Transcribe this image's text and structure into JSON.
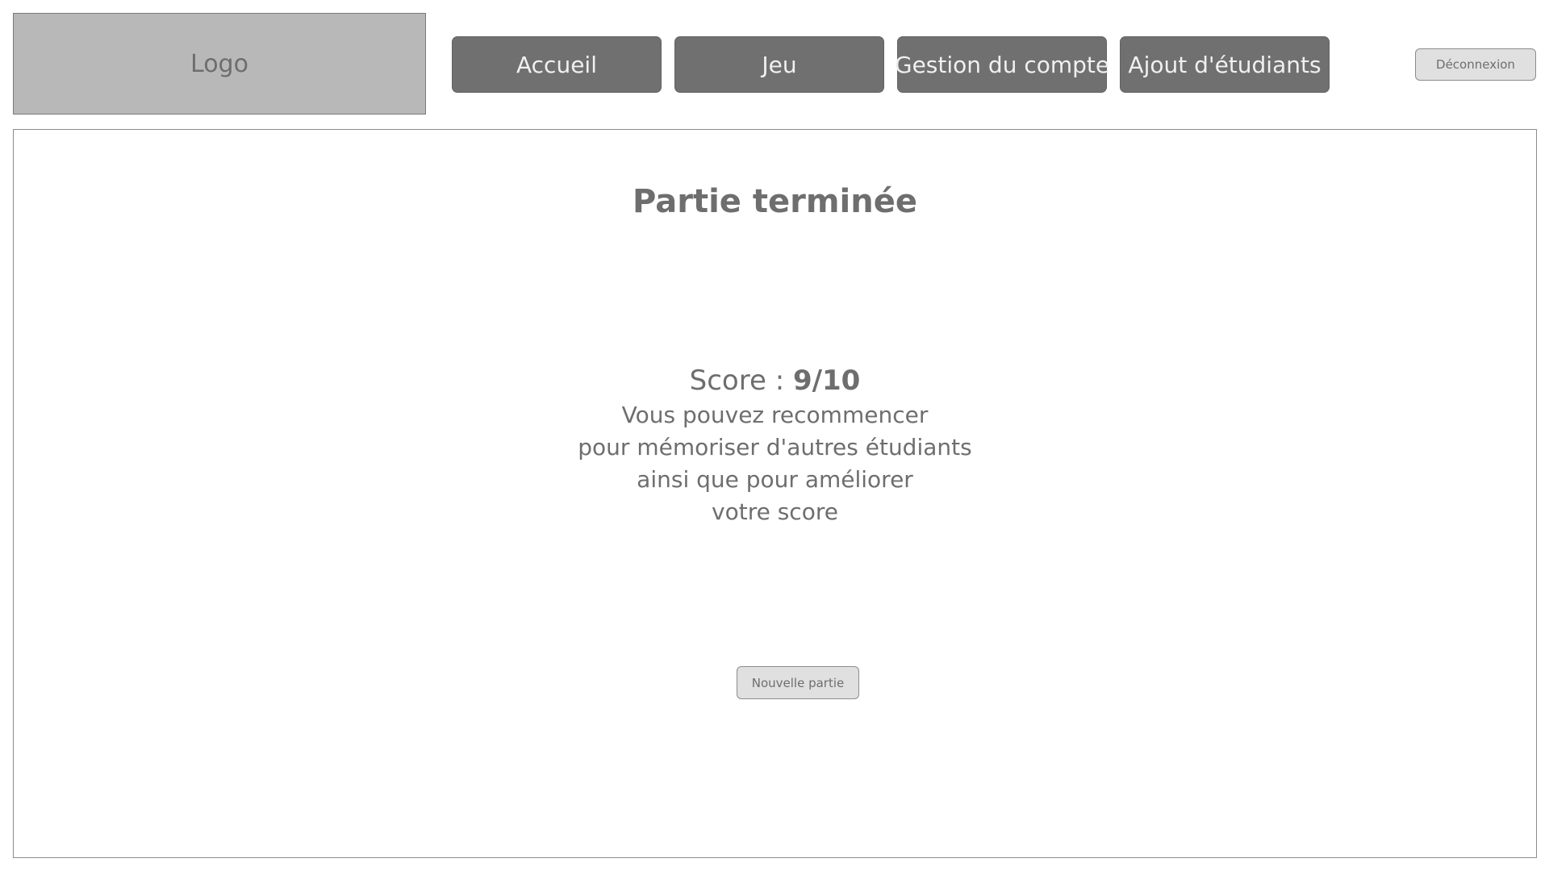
{
  "header": {
    "logo_text": "Logo",
    "nav": [
      {
        "label": "Accueil"
      },
      {
        "label": "Jeu"
      },
      {
        "label": "Gestion du compte"
      },
      {
        "label": "Ajout d'étudiants"
      }
    ],
    "logout_label": "Déconnexion"
  },
  "main": {
    "title": "Partie terminée",
    "score_label": "Score : ",
    "score_value": "9/10",
    "message_lines": [
      "Vous pouvez recommencer",
      "pour mémoriser d'autres étudiants",
      "ainsi que pour améliorer",
      "votre score"
    ],
    "new_game_label": "Nouvelle partie"
  },
  "colors": {
    "nav_button_bg": "#707070",
    "logo_bg": "#b8b8b8",
    "secondary_button_bg": "#e0e0e0",
    "text": "#6e6e6e"
  }
}
